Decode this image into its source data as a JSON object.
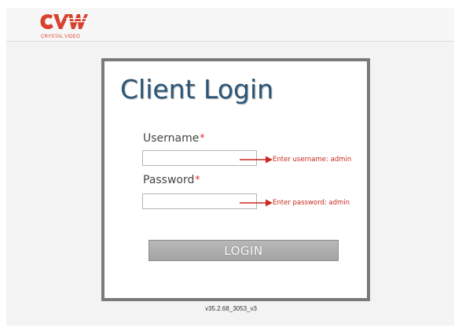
{
  "brand": {
    "logo_text": "CVW",
    "caption": "CRYSTAL VIDEO",
    "color": "#d8432f",
    "icon": "cvw-logo-icon"
  },
  "login": {
    "title": "Client Login",
    "title_color": "#2b5677",
    "username": {
      "label": "Username",
      "required_mark": "*",
      "value": "",
      "hint": "Enter username: admin"
    },
    "password": {
      "label": "Password",
      "required_mark": "*",
      "value": "",
      "hint": "Enter password: admin"
    },
    "button_label": "LOGIN",
    "hint_color": "#c8281e"
  },
  "footer": {
    "version": "v35.2.68_3053_v3"
  }
}
